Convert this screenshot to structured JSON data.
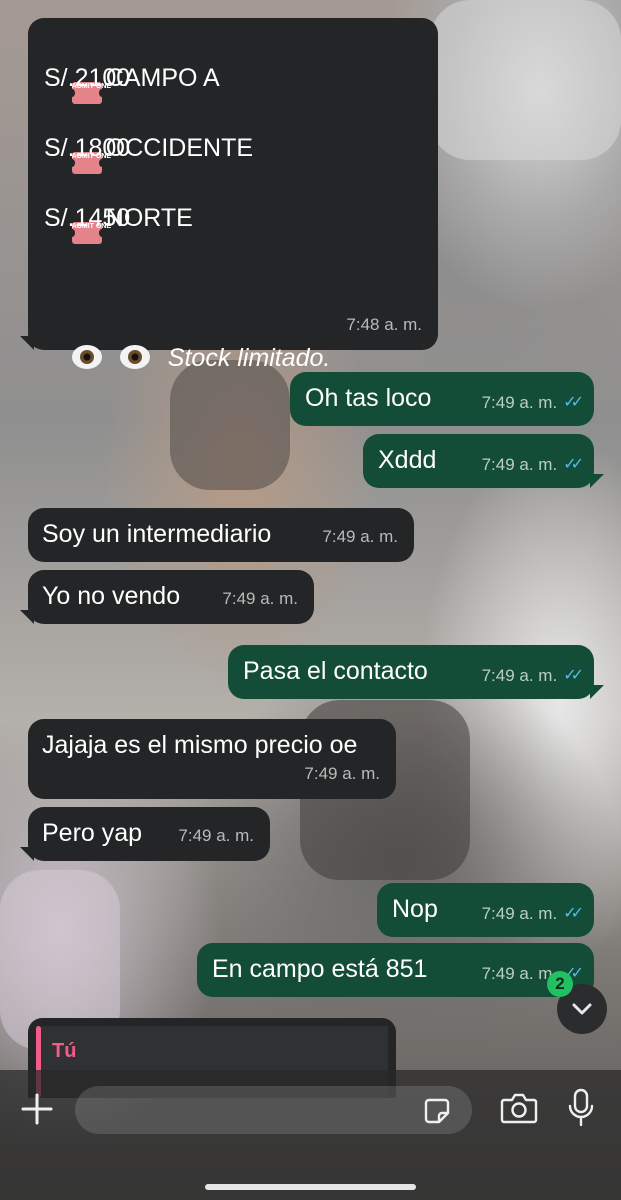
{
  "messages": {
    "m1": {
      "lines": [
        {
          "ticket": true,
          "text": "CAMPO A"
        },
        {
          "ticket": false,
          "text": "S/.2100"
        },
        {
          "ticket": true,
          "text": "OCCIDENTE"
        },
        {
          "ticket": false,
          "text": "S/.1800"
        },
        {
          "ticket": true,
          "text": "NORTE"
        },
        {
          "ticket": false,
          "text": "S/.1450"
        }
      ],
      "ticket_label": "ADMIT ONE",
      "footer": "Stock limitado.",
      "time": "7:48 a. m."
    },
    "m2": {
      "text": "Oh tas loco",
      "time": "7:49 a. m."
    },
    "m3": {
      "text": "Xddd",
      "time": "7:49 a. m."
    },
    "m4": {
      "text": "Soy un intermediario",
      "time": "7:49 a. m."
    },
    "m5": {
      "text": "Yo no vendo",
      "time": "7:49 a. m."
    },
    "m6": {
      "text": "Pasa el contacto",
      "time": "7:49 a. m."
    },
    "m7": {
      "text": "Jajaja es el mismo precio oe",
      "time": "7:49 a. m."
    },
    "m8": {
      "text": "Pero yap",
      "time": "7:49 a. m."
    },
    "m9": {
      "text": "Nop",
      "time": "7:49 a. m."
    },
    "m10": {
      "text": "En campo está 851",
      "time": "7:49 a. m."
    }
  },
  "reply_preview": {
    "author": "Tú"
  },
  "unread_count": "2",
  "icons": {
    "read_receipt": "double-check-icon",
    "scroll_down": "chevron-down-icon",
    "attach": "plus-icon",
    "sticker": "sticker-icon",
    "camera": "camera-icon",
    "mic": "microphone-icon",
    "eyes": "eyes-emoji",
    "ticket": "admit-one-ticket-emoji"
  },
  "colors": {
    "incoming_bubble": "#232526",
    "outgoing_bubble": "#144d37",
    "read_tick": "#53bdeb",
    "unread_badge": "#21c063",
    "reply_accent": "#f15c8b"
  }
}
